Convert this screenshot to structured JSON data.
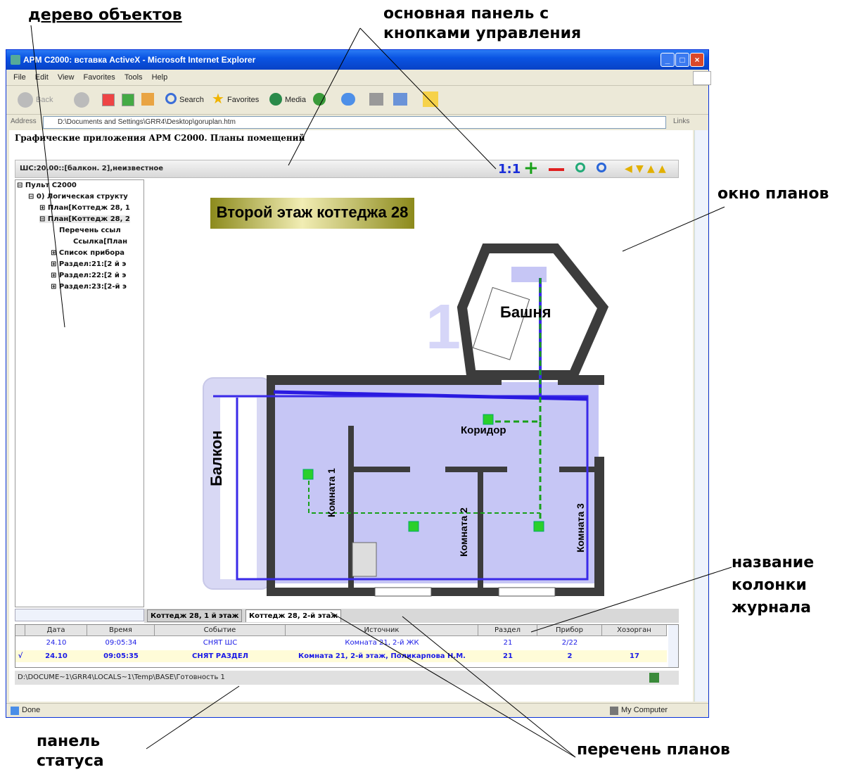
{
  "callouts": {
    "object_tree": "дерево объектов",
    "main_panel_line1": "основная панель с",
    "main_panel_line2": "кнопками управления",
    "plans_window": "окно планов",
    "column_name_line1": "название",
    "column_name_line2": "колонки",
    "column_name_line3": "журнала",
    "status_panel_line1": "панель",
    "status_panel_line2": "статуса",
    "plans_list": "перечень планов"
  },
  "window": {
    "title": "АРМ С2000: вставка ActiveX - Microsoft Internet Explorer",
    "menu": [
      "File",
      "Edit",
      "View",
      "Favorites",
      "Tools",
      "Help"
    ],
    "toolbar": {
      "back": "Back",
      "search": "Search",
      "favorites": "Favorites",
      "media": "Media"
    },
    "address_label": "Address",
    "address_value": "D:\\Documents and Settings\\GRR4\\Desktop\\goruplan.htm",
    "links_label": "Links",
    "status_left": "Done",
    "status_right": "My Computer"
  },
  "app": {
    "page_title": "Графические приложения АРМ С2000. Планы помещений",
    "object_label": "ШС:20.00::[балкон. 2],неизвестное",
    "zoom_one": "1:1",
    "plan_banner": "Второй этаж коттеджа 28",
    "rooms": {
      "tower": "Башня",
      "corridor": "Коридор",
      "balcony": "Балкон",
      "room1": "Комната 1",
      "room2": "Комната 2",
      "room3": "Комната 3"
    },
    "tree": [
      "Пульт С2000",
      "0) Логическая структу",
      "План[Коттедж 28, 1",
      "План[Коттедж 28, 2",
      "Перечень ссыл",
      "Ссылка[План",
      "Список прибора",
      "Раздел:21:[2 й э",
      "Раздел:22:[2 й э",
      "Раздел:23:[2-й э"
    ],
    "tabs": [
      "Коттедж 28, 1 й этаж",
      "Коттедж 28, 2-й этаж"
    ],
    "journal": {
      "headers": [
        "Дата",
        "Время",
        "Событие",
        "Источник",
        "Раздел",
        "Прибор",
        "Хозорган"
      ],
      "rows": [
        [
          "24.10",
          "09:05:34",
          "СНЯТ ШС",
          "Комната 21, 2-й ЖК",
          "21",
          "2/22",
          ""
        ],
        [
          "24.10",
          "09:05:35",
          "СНЯТ РАЗДЕЛ",
          "Комната 21, 2-й этаж, Поликарпова Н.М.",
          "21",
          "2",
          "17"
        ]
      ]
    },
    "status_path": "D:\\DOCUME~1\\GRR4\\LOCALS~1\\Temp\\BASE\\Готовность 1"
  }
}
